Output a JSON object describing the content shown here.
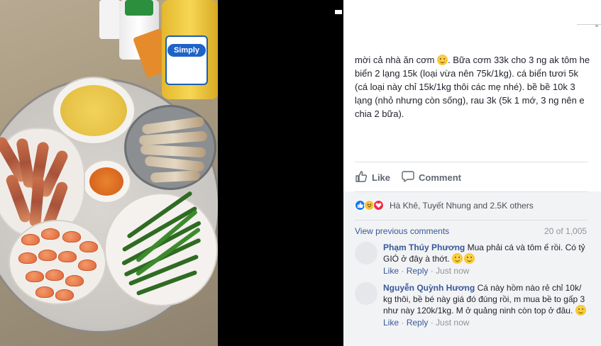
{
  "post": {
    "text_lines": [
      "mời cả nhà ăn cơm ",
      ". Bữa cơm 33k cho 3 ng ak tôm he biển 2 lạng 15k (loại vừa nên 75k/1kg). cá biển tươi 5k (cá loại này chỉ 15k/1kg thôi các mẹ nhé). bề bề 10k 3 lạng (nhỏ nhưng còn sống), rau 3k (5k 1 mớ, 3 ng nên e chia 2 bữa)."
    ],
    "emoji": "slightly-smiling-face"
  },
  "photo": {
    "oil_brand": "Simply"
  },
  "actions": {
    "like_label": "Like",
    "comment_label": "Comment"
  },
  "reactions": {
    "icons": [
      "like",
      "haha",
      "love"
    ],
    "names": "Hà Khê, Tuyết Nhung and 2.5K others"
  },
  "comments_header": {
    "view_previous": "View previous comments",
    "count": "20 of 1,005"
  },
  "comments": [
    {
      "author": "Phạm Thúy Phương",
      "text": "Mua phải cá và tôm ế rồi. Có tỷ GIÓ ở đây à thớt.",
      "emojis": 2,
      "like": "Like",
      "reply": "Reply",
      "time": "Just now"
    },
    {
      "author": "Nguyễn Quỳnh Hương",
      "text": "Cá này hồm nào rẻ chỉ 10k/ kg thôi, bề bé này giá đó đúng rồi, m mua bề to gấp 3 như này 120k/1kg. M ở quảng ninh còn top ở đâu.",
      "emojis": 1,
      "like": "Like",
      "reply": "Reply",
      "time": "Just now"
    }
  ],
  "colors": {
    "link": "#385898",
    "text": "#1d2129",
    "muted": "#90949c",
    "panel_bg": "#f2f3f5",
    "like_blue": "#1877f2",
    "love_red": "#f0284a"
  }
}
